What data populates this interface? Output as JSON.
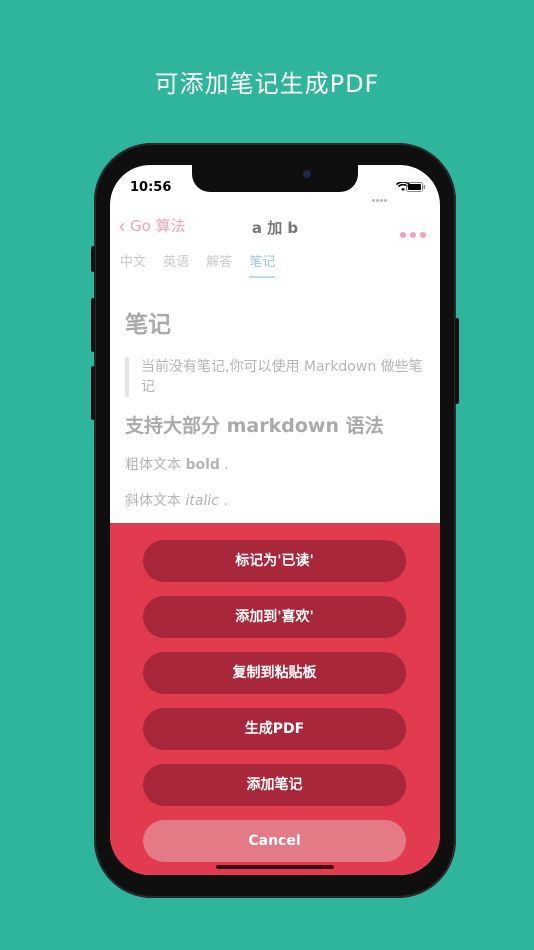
{
  "caption": "可添加笔记生成PDF",
  "status_bar": {
    "time": "10:56"
  },
  "nav": {
    "back_label": "Go 算法",
    "title": "a 加 b"
  },
  "tabs": [
    {
      "label": "中文"
    },
    {
      "label": "英语"
    },
    {
      "label": "解答"
    },
    {
      "label": "笔记"
    }
  ],
  "content": {
    "heading": "笔记",
    "quote": "当前没有笔记,你可以使用 Markdown 做些笔记",
    "subheading": "支持大部分 markdown 语法",
    "bold_prefix": "粗体文本",
    "bold_word": "bold",
    "italic_prefix": "斜体文本",
    "italic_word": "italic",
    "period": "."
  },
  "action_sheet": {
    "actions": [
      {
        "label": "标记为'已读'"
      },
      {
        "label": "添加到'喜欢'"
      },
      {
        "label": "复制到粘贴板"
      },
      {
        "label": "生成PDF"
      },
      {
        "label": "添加笔记"
      }
    ],
    "cancel_label": "Cancel"
  },
  "colors": {
    "background": "#2fb59b",
    "sheet": "#e23a4e",
    "action_button": "#a8273a",
    "accent_pink": "#f4a3b3",
    "tab_active": "#9ec8f0"
  },
  "icons": [
    "chevron-left-icon",
    "more-icon",
    "wifi-icon",
    "battery-icon",
    "signal-icon"
  ]
}
